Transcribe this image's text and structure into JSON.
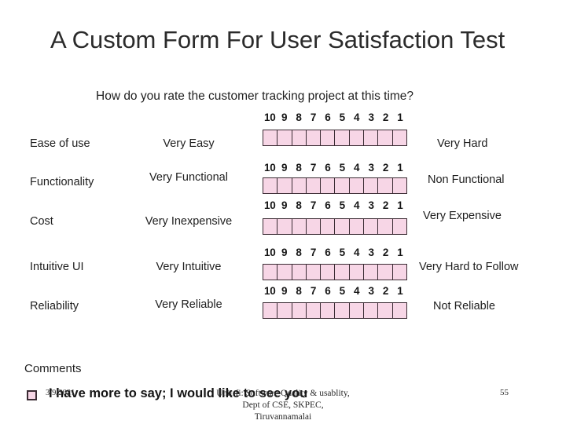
{
  "slide": {
    "title": "A Custom Form For User Satisfaction Test",
    "question": "How do you rate the customer tracking project at this time?"
  },
  "scale": {
    "labels": [
      "10",
      "9",
      "8",
      "7",
      "6",
      "5",
      "4",
      "3",
      "2",
      "1"
    ],
    "cell_count": 10,
    "fill_color": "#f7d6e6",
    "border_color": "#3a2b33"
  },
  "rows": [
    {
      "criterion": "Ease of use",
      "low_label": "Very Easy",
      "high_label": "Very Hard"
    },
    {
      "criterion": "Functionality",
      "low_label": "Very Functional",
      "high_label": "Non Functional"
    },
    {
      "criterion": "Cost",
      "low_label": "Very Inexpensive",
      "high_label": "Very Expensive"
    },
    {
      "criterion": "Intuitive UI",
      "low_label": "Very Intuitive",
      "high_label": "Very Hard to Follow"
    },
    {
      "criterion": "Reliability",
      "low_label": "Very Reliable",
      "high_label": "Not Reliable"
    }
  ],
  "comments": {
    "heading": "Comments",
    "checkbox_label": "I have more to say; I would like to see you",
    "checkbox_checked": true
  },
  "footer": {
    "date": "3/9/2021",
    "line1": "Unit-fi: Software Quality & usablity,",
    "line2": "Dept of CSE, SKPEC,",
    "line3": "Tiruvannamalai",
    "page_number": "55"
  }
}
